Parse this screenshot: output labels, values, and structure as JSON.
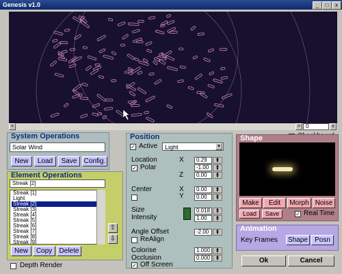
{
  "window": {
    "title": "Genesis v1.0",
    "min_glyph": "_",
    "max_glyph": "□",
    "close_glyph": "x"
  },
  "scroll": {
    "left_glyph": "<",
    "right_glyph": ">",
    "value": "0",
    "close_glyph": "x"
  },
  "checkerboard_label": "Checkboard",
  "system_ops": {
    "title": "System Operations",
    "value": "Solar Wind",
    "buttons": {
      "new": "New",
      "load": "Load",
      "save": "Save",
      "config": "Config."
    }
  },
  "element_ops": {
    "title": "Element Operations",
    "selected": "Streak [2]",
    "items": [
      "Streak [1]",
      "Light",
      "Streak [2]",
      "Streak [3]",
      "Streak [4]",
      "Streak [5]",
      "Streak [6]",
      "Streak [7]",
      "Streak [8]",
      "Streak [9]"
    ],
    "selected_index": 2,
    "buttons": {
      "new": "New",
      "copy": "Copy",
      "delete": "Delete"
    },
    "up_glyph": "⇧",
    "down_glyph": "⇩"
  },
  "depth_render_label": "Depth Render",
  "position": {
    "title": "Position",
    "active_label": "Active",
    "active_checked": true,
    "type_value": "Light",
    "location_label": "Location",
    "polar_label": "Polar",
    "polar_checked": true,
    "x_label": "X",
    "y_label": "Y",
    "z_label": "Z",
    "loc_x": "0.29",
    "loc_y": "-1.00",
    "loc_z": "0.00",
    "center_label": "Center",
    "center_x": "0.00",
    "center_y": "0.00",
    "size_label": "Size",
    "intensity_label": "Intensity",
    "size_value": "0.018",
    "intensity_value": "1.00",
    "angle_label": "Angle Offset",
    "angle_value": "-2.00",
    "realign_label": "ReAlign",
    "colorise_label": "Colorise",
    "occlusion_label": "Occlusion",
    "colorise_value": "1.000",
    "occlusion_value": "0.000",
    "offscreen_label": "Off Screen",
    "offscreen_checked": true
  },
  "shape": {
    "title": "Shape",
    "buttons": {
      "make": "Make",
      "edit": "Edit",
      "morph": "Morph",
      "noise": "Noise",
      "load": "Load",
      "save": "Save"
    },
    "realtime_label": "Real Time",
    "realtime_checked": true
  },
  "animation": {
    "title": "Animation",
    "keyframes_label": "Key Frames",
    "buttons": {
      "shape": "Shape",
      "posn": "Posn"
    }
  },
  "ok_label": "Ok",
  "cancel_label": "Cancel",
  "colors": {
    "viewport_bg": "#17102f",
    "particles": "#c988b8",
    "panel": "#aec0be",
    "button": "#c8c4ff",
    "shape_panel": "#b07f8a"
  }
}
